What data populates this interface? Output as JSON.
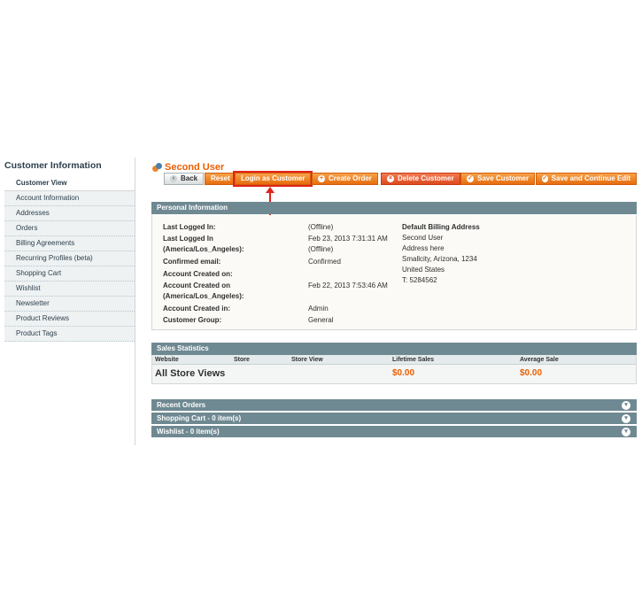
{
  "sidebar": {
    "title": "Customer Information",
    "items": [
      {
        "label": "Customer View"
      },
      {
        "label": "Account Information"
      },
      {
        "label": "Addresses"
      },
      {
        "label": "Orders"
      },
      {
        "label": "Billing Agreements"
      },
      {
        "label": "Recurring Profiles (beta)"
      },
      {
        "label": "Shopping Cart"
      },
      {
        "label": "Wishlist"
      },
      {
        "label": "Newsletter"
      },
      {
        "label": "Product Reviews"
      },
      {
        "label": "Product Tags"
      }
    ]
  },
  "header": {
    "title": "Second User"
  },
  "toolbar": {
    "back": "Back",
    "reset": "Reset",
    "login_as_customer": "Login as Customer",
    "create_order": "Create Order",
    "delete_customer": "Delete Customer",
    "save_customer": "Save Customer",
    "save_continue": "Save and Continue Edit"
  },
  "personal": {
    "heading": "Personal Information",
    "rows": [
      {
        "label": "Last Logged In:",
        "value": "(Offline)"
      },
      {
        "label": "Last Logged In",
        "value": "Feb 23, 2013 7:31:31 AM"
      },
      {
        "label": "(America/Los_Angeles):",
        "value": "(Offline)"
      },
      {
        "label": "Confirmed email:",
        "value": "Confirmed"
      },
      {
        "label": "Account Created on:",
        "value": ""
      },
      {
        "label": "Account Created on",
        "value": "Feb 22, 2013 7:53:46 AM"
      },
      {
        "label": "(America/Los_Angeles):",
        "value": ""
      },
      {
        "label": "Account Created in:",
        "value": "Admin"
      },
      {
        "label": "Customer Group:",
        "value": "General"
      }
    ],
    "address": {
      "title": "Default Billing Address",
      "lines": [
        "Second User",
        "Address here",
        "Smallcity, Arizona, 1234",
        "United States",
        "T: 5284562"
      ]
    }
  },
  "sales": {
    "heading": "Sales Statistics",
    "columns": [
      "Website",
      "Store",
      "Store View",
      "Lifetime Sales",
      "Average Sale"
    ],
    "row": {
      "label": "All Store Views",
      "lifetime": "$0.00",
      "average": "$0.00"
    }
  },
  "sections": [
    {
      "label": "Recent Orders"
    },
    {
      "label": "Shopping Cart - 0 item(s)"
    },
    {
      "label": "Wishlist - 0 item(s)"
    }
  ],
  "colors": {
    "accent": "#eb5e00",
    "section_header": "#6f8992",
    "money": "#eb5e00",
    "highlight": "#e2231a"
  }
}
